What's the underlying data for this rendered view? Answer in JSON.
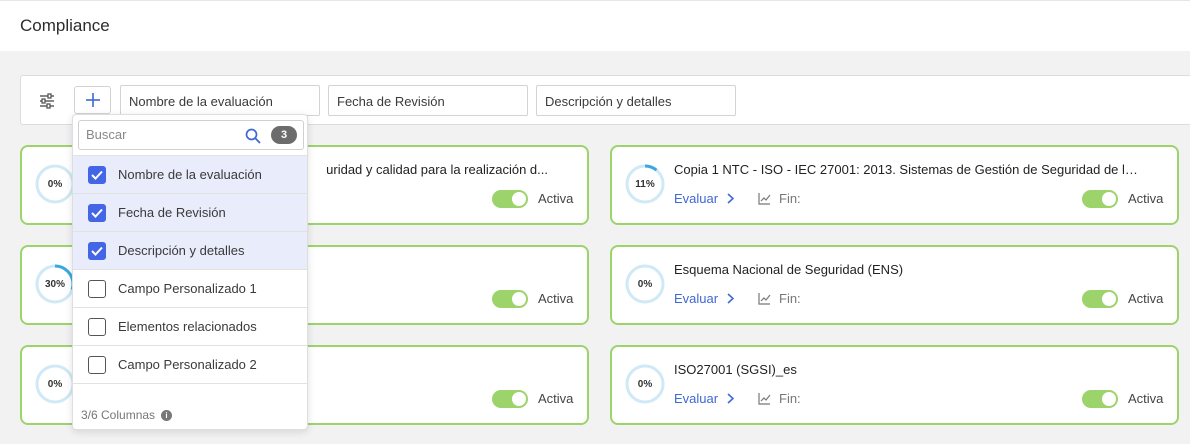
{
  "page": {
    "title": "Compliance"
  },
  "filter_bar": {
    "columns": [
      "Nombre de la evaluación",
      "Fecha de Revisión",
      "Descripción y detalles"
    ]
  },
  "dropdown": {
    "search_placeholder": "Buscar",
    "selected_count": "3",
    "items": [
      {
        "label": "Nombre de la evaluación",
        "checked": true
      },
      {
        "label": "Fecha de Revisión",
        "checked": true
      },
      {
        "label": "Descripción y detalles",
        "checked": true
      },
      {
        "label": "Campo Personalizado 1",
        "checked": false
      },
      {
        "label": "Elementos relacionados",
        "checked": false
      },
      {
        "label": "Campo Personalizado 2",
        "checked": false
      }
    ],
    "footer": "3/6 Columnas"
  },
  "cards": [
    {
      "progress_label": "0%",
      "progress": 0,
      "title": "uridad y calidad para la realización d...",
      "evaluar": "",
      "fin": "",
      "status": "Activa"
    },
    {
      "progress_label": "11%",
      "progress": 11,
      "title": "Copia 1 NTC - ISO - IEC 27001: 2013. Sistemas de Gestión de Seguridad de la ...",
      "evaluar": "Evaluar",
      "fin": "Fin:",
      "status": "Activa"
    },
    {
      "progress_label": "30%",
      "progress": 30,
      "title": "",
      "evaluar": "",
      "fin": "",
      "status": "Activa"
    },
    {
      "progress_label": "0%",
      "progress": 0,
      "title": "Esquema Nacional de Seguridad (ENS)",
      "evaluar": "Evaluar",
      "fin": "Fin:",
      "status": "Activa"
    },
    {
      "progress_label": "0%",
      "progress": 0,
      "title": "",
      "evaluar": "",
      "fin": "",
      "status": "Activa"
    },
    {
      "progress_label": "0%",
      "progress": 0,
      "title": "ISO27001 (SGSI)_es",
      "evaluar": "Evaluar",
      "fin": "Fin:",
      "status": "Activa"
    }
  ],
  "colors": {
    "accent": "#4466e6",
    "card_border": "#9cd36b",
    "toggle_on": "#9cd36b",
    "ring_track": "#cfe9f6",
    "ring_progress": "#3aa8e0"
  }
}
